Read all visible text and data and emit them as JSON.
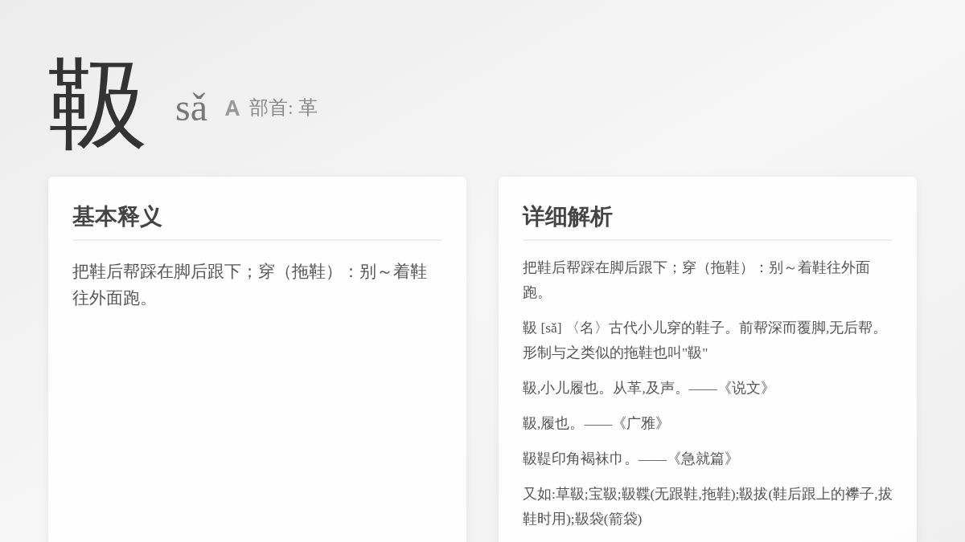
{
  "header": {
    "character": "靸",
    "pinyin": "sǎ",
    "radical": "部首: 革"
  },
  "basic": {
    "title": "基本释义",
    "text": "把鞋后帮踩在脚后跟下；穿（拖鞋）：别～着鞋往外面跑。"
  },
  "detail": {
    "title": "详细解析",
    "paragraphs": [
      "把鞋后帮踩在脚后跟下；穿（拖鞋）：别～着鞋往外面跑。",
      "靸 [sǎ] 〈名〉古代小儿穿的鞋子。前帮深而覆脚,无后帮。形制与之类似的拖鞋也叫\"靸\"",
      "靸,小儿履也。从革,及声。——《说文》",
      "靸,履也。——《广雅》",
      "靸鞮印角褐袜巾。——《急就篇》",
      "又如:草靸;宝靸;靸鞢(无跟鞋,拖鞋);靸拔(鞋后跟上的襻子,拔鞋时用);靸袋(箭袋)"
    ]
  }
}
